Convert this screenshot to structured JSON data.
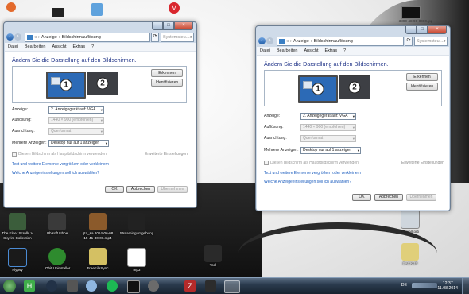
{
  "desktop": {
    "file_label": "3890-48-90-0000.jpg",
    "icons": [
      {
        "label": "The Elder Scrolls V Skyrim Collection",
        "color": "#3b5d3b"
      },
      {
        "label": "Ubisoft Ubbe",
        "color": "#3a3a3a"
      },
      {
        "label": "gta_sa 2014-06-08 15-41-30-06.mp4",
        "color": "#8b5a2b"
      },
      {
        "label": "Streamingumgebung",
        "color": "#222"
      },
      {
        "label": "Papierkorb",
        "color": "#cfd6dd"
      },
      {
        "label": "Flypsy",
        "color": "#1a1a1a"
      },
      {
        "label": "IObit Uninstaller",
        "color": "#2e8b2e"
      },
      {
        "label": "FreeFileSync",
        "color": "#d4c063"
      },
      {
        "label": "mp3",
        "color": "#ffffff"
      },
      {
        "label": "Tool",
        "color": "#2a2a2a"
      },
      {
        "label": "BACKUP",
        "color": "#e0cf7a"
      }
    ]
  },
  "left_window": {
    "address_prefix": "«",
    "crumb1": "Anzeige",
    "crumb2": "Bildschirmauflösung",
    "search_placeholder": "Systemsteu...",
    "menu": [
      "Datei",
      "Bearbeiten",
      "Ansicht",
      "Extras",
      "?"
    ],
    "heading": "Ändern Sie die Darstellung auf den Bildschirmen.",
    "monitor1": "1",
    "monitor2": "2",
    "erkennen": "Erkennen",
    "identifizieren": "Identifizieren",
    "anzeige_label": "Anzeige:",
    "anzeige_value": "2. Anzeigegerät auf: VGA",
    "aufloesung_label": "Auflösung:",
    "aufloesung_value": "1440 × 900 (empfohlen)",
    "ausrichtung_label": "Ausrichtung:",
    "ausrichtung_value": "Querformat",
    "mehrere_label": "Mehrere Anzeigen:",
    "mehrere_value": "Desktop nur auf 1 anzeigen",
    "hauptbildschirm": "Diesen Bildschirm als Hauptbildschirm verwenden",
    "erweitert": "Erweiterte Einstellungen",
    "link1": "Text und weitere Elemente vergrößern oder verkleinern",
    "link2": "Welche Anzeigeeinstellungen soll ich auswählen?",
    "ok": "OK",
    "abbrechen": "Abbrechen",
    "uebernehmen": "Übernehmen"
  },
  "right_window": {
    "address_prefix": "«",
    "crumb1": "Anzeige",
    "crumb2": "Bildschirmauflösung",
    "search_placeholder": "Systemsteu...",
    "menu": [
      "Datei",
      "Bearbeiten",
      "Ansicht",
      "Extras",
      "?"
    ],
    "heading": "Ändern Sie die Darstellung auf den Bildschirmen.",
    "monitor1": "1",
    "monitor2": "2",
    "erkennen": "Erkennen",
    "identifizieren": "Identifizieren",
    "anzeige_label": "Anzeige:",
    "anzeige_value": "2. Anzeigegerät auf: VGA",
    "aufloesung_label": "Auflösung:",
    "aufloesung_value": "1440 × 900 (empfohlen)",
    "ausrichtung_label": "Ausrichtung:",
    "ausrichtung_value": "Querformat",
    "mehrere_label": "Mehrere Anzeigen:",
    "mehrere_value": "Desktop nur auf 1 anzeigen",
    "hauptbildschirm": "Diesen Bildschirm als Hauptbildschirm verwenden",
    "erweitert": "Erweiterte Einstellungen",
    "link1": "Text und weitere Elemente vergrößern oder verkleinern",
    "link2": "Welche Anzeigeeinstellungen soll ich auswählen?",
    "ok": "OK",
    "abbrechen": "Abbrechen",
    "uebernehmen": "Übernehmen"
  },
  "taskbar": {
    "lang": "DE",
    "time": "12:37",
    "date": "11.08.2014",
    "icons": [
      "start-orb-icon",
      "green-app-icon",
      "steam-icon",
      "media-icon",
      "itunes-icon",
      "spotify-icon",
      "terminal-icon",
      "tool-icon",
      "filezilla-icon",
      "grid-app-icon",
      "display-settings-icon"
    ]
  }
}
